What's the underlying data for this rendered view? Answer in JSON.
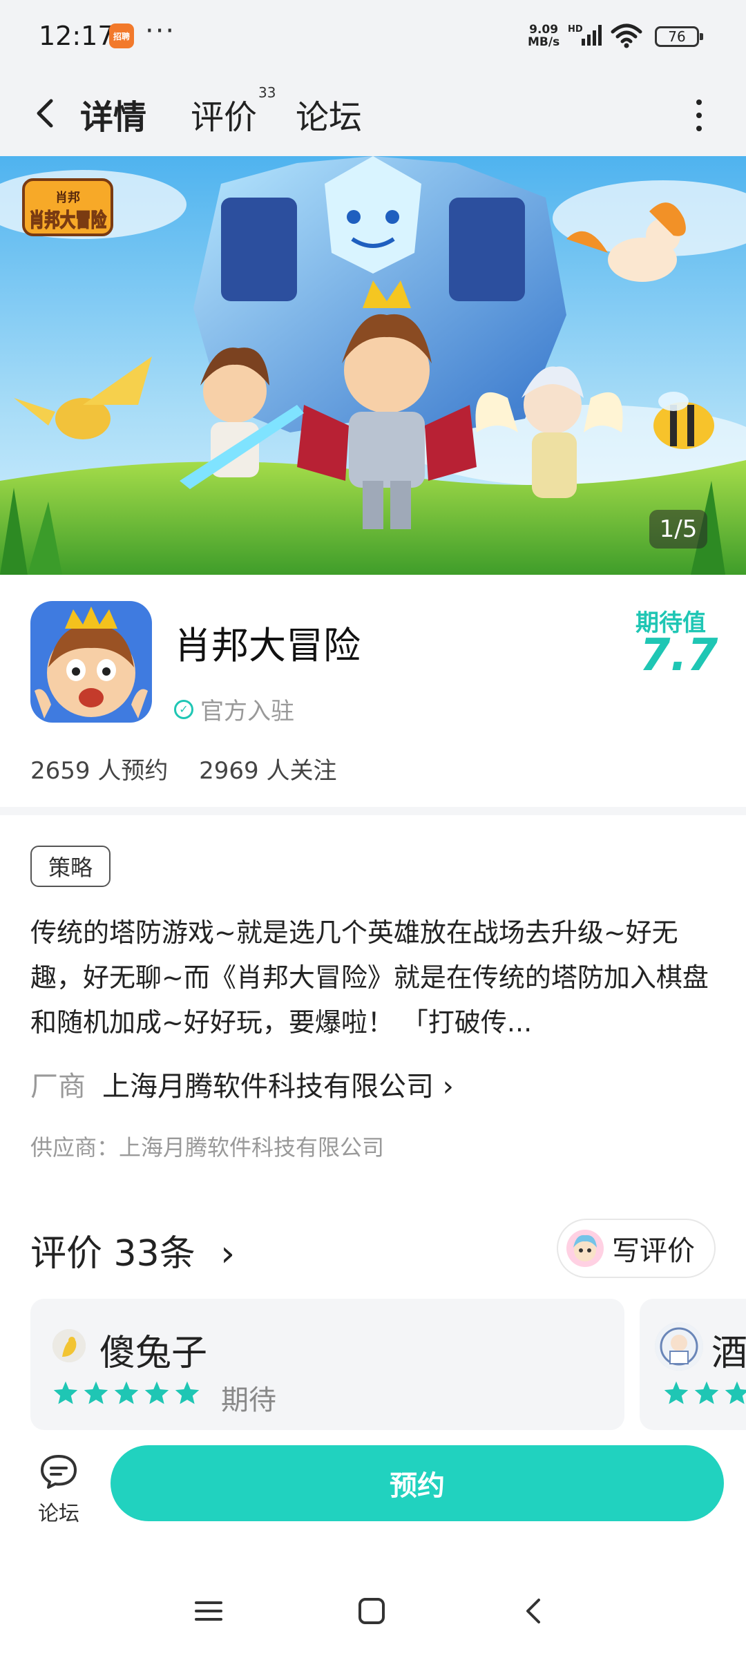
{
  "status_bar": {
    "time": "12:17",
    "app_badge": "招聘",
    "more": "···",
    "net_speed_value": "9.09",
    "net_speed_unit": "MB/s",
    "signal_label": "HD",
    "battery": "76"
  },
  "nav": {
    "tabs": [
      {
        "label": "详情",
        "active": true
      },
      {
        "label": "评价",
        "count": "33"
      },
      {
        "label": "论坛"
      }
    ]
  },
  "banner": {
    "logo_text": "肖邦大冒险",
    "logo_subtext": "肖邦",
    "counter": "1/5"
  },
  "app": {
    "name": "肖邦大冒险",
    "verified_label": "官方入驻",
    "expect_label": "期待值",
    "expect_score": "7.7",
    "reservations": "2659 人预约",
    "followers": "2969 人关注"
  },
  "details": {
    "tag": "策略",
    "description": "传统的塔防游戏~就是选几个英雄放在战场去升级~好无趣，好无聊~而《肖邦大冒险》就是在传统的塔防加入棋盘和随机加成~好好玩，要爆啦！ 「打破传...",
    "maker_key": "厂商",
    "maker_value": "上海月腾软件科技有限公司",
    "supplier": "供应商：上海月腾软件科技有限公司"
  },
  "reviews": {
    "title": "评价",
    "count": "33条",
    "write_label": "写评价",
    "cards": [
      {
        "name": "傻兔子",
        "rating": 5,
        "tag": "期待"
      },
      {
        "name": "酒",
        "rating": 3
      }
    ]
  },
  "bottom": {
    "forum_label": "论坛",
    "reserve_label": "预约"
  },
  "colors": {
    "accent": "#21d2bf",
    "star": "#1fc6b4",
    "nav_bg": "#f2f3f5"
  },
  "icons": {
    "back": "back-chevron-icon",
    "more": "more-vertical-icon",
    "verified": "check-circle-icon",
    "forum": "chat-bubble-icon",
    "star": "star-icon"
  }
}
